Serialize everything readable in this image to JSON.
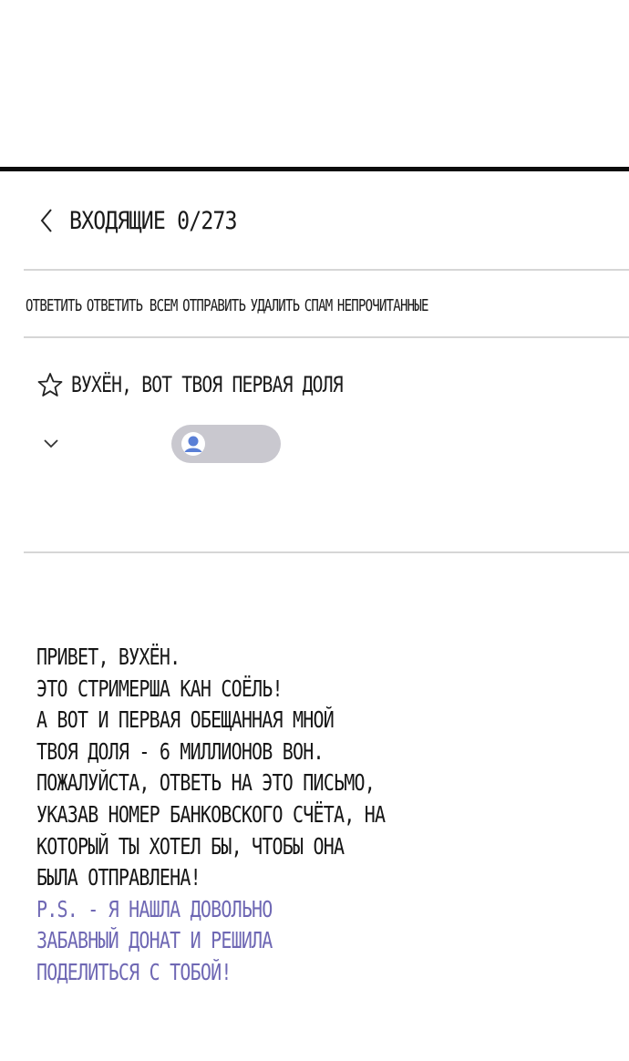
{
  "header": {
    "title": "ВХОДЯЩИЕ 0/273",
    "back_icon": "chevron-left-icon"
  },
  "toolbar": {
    "items": [
      "ОТВЕТИТЬ",
      "ОТВЕТИТЬ ВСЕМ",
      "ОТПРАВИТЬ",
      "УДАЛИТЬ",
      "СПАМ",
      "НЕПРОЧИТАННЫЕ"
    ]
  },
  "message": {
    "star_icon": "star-outline-icon",
    "subject": "ВУХЁН, ВОТ ТВОЯ ПЕРВАЯ ДОЛЯ",
    "expand_icon": "chevron-down-icon",
    "sender_avatar_icon": "user-avatar-icon",
    "sender_chip_color": "#c9c8cf",
    "body_lines": [
      "ПРИВЕТ, ВУХЁН.",
      "ЭТО СТРИМЕРША КАН СОЁЛЬ!",
      "А ВОТ И ПЕРВАЯ ОБЕЩАННАЯ МНОЙ",
      "ТВОЯ ДОЛЯ - 6 МИЛЛИОНОВ ВОН.",
      "ПОЖАЛУЙСТА, ОТВЕТЬ НА ЭТО ПИСЬМО,",
      "УКАЗАВ НОМЕР БАНКОВСКОГО СЧЁТА, НА",
      "КОТОРЫЙ ТЫ ХОТЕЛ БЫ, ЧТОБЫ ОНА",
      "БЫЛА ОТПРАВЛЕНА!"
    ],
    "ps_lines": [
      "P.S. - Я НАШЛА ДОВОЛЬНО",
      "ЗАБАВНЫЙ ДОНАТ И РЕШИЛА",
      "ПОДЕЛИТЬСЯ С ТОБОЙ!"
    ],
    "ps_color": "#6f68b4"
  }
}
